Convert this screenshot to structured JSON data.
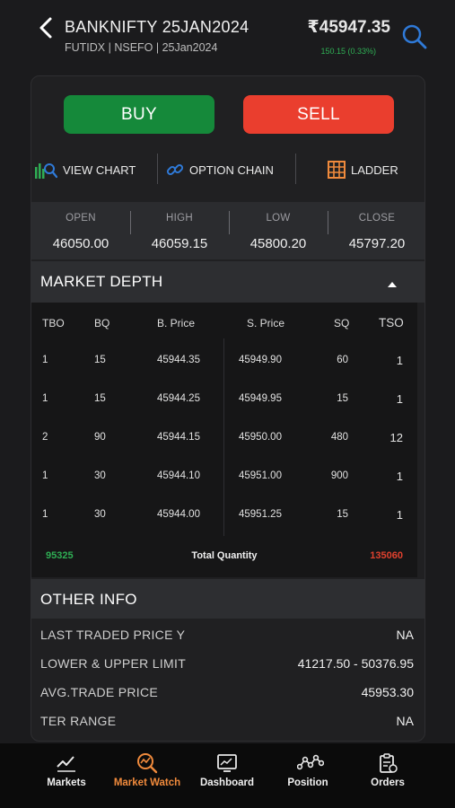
{
  "header": {
    "symbol": "BANKNIFTY 25JAN2024",
    "subtitle": "FUTIDX | NSEFO | 25Jan2024",
    "ltp": "₹45947.35",
    "change": "150.15 (0.33%)"
  },
  "colors": {
    "buy": "#15893a",
    "sell": "#ea3e2e",
    "positive": "#2fae54",
    "negative": "#e0412e",
    "accent": "#f08a3c",
    "search": "#2f7ad8"
  },
  "buttons": {
    "buy": "BUY",
    "sell": "SELL"
  },
  "actions": {
    "view_chart": "VIEW CHART",
    "option_chain": "OPTION CHAIN",
    "ladder": "LADDER"
  },
  "ohlc": [
    {
      "label": "OPEN",
      "value": "46050.00"
    },
    {
      "label": "HIGH",
      "value": "46059.15"
    },
    {
      "label": "LOW",
      "value": "45800.20"
    },
    {
      "label": "CLOSE",
      "value": "45797.20"
    }
  ],
  "market_depth": {
    "title": "MARKET DEPTH",
    "columns": {
      "tbo": "TBO",
      "bq": "BQ",
      "bprice": "B. Price",
      "sprice": "S. Price",
      "sq": "SQ",
      "tso": "TSO"
    },
    "rows": [
      {
        "tbo": "1",
        "bq": "15",
        "bprice": "45944.35",
        "sprice": "45949.90",
        "sq": "60",
        "tso": "1"
      },
      {
        "tbo": "1",
        "bq": "15",
        "bprice": "45944.25",
        "sprice": "45949.95",
        "sq": "15",
        "tso": "1"
      },
      {
        "tbo": "2",
        "bq": "90",
        "bprice": "45944.15",
        "sprice": "45950.00",
        "sq": "480",
        "tso": "12"
      },
      {
        "tbo": "1",
        "bq": "30",
        "bprice": "45944.10",
        "sprice": "45951.00",
        "sq": "900",
        "tso": "1"
      },
      {
        "tbo": "1",
        "bq": "30",
        "bprice": "45944.00",
        "sprice": "45951.25",
        "sq": "15",
        "tso": "1"
      }
    ],
    "total_buy": "95325",
    "total_label": "Total Quantity",
    "total_sell": "135060"
  },
  "other_info": {
    "title": "OTHER INFO",
    "rows": [
      {
        "label": "LAST TRADED PRICE Y",
        "value": "NA"
      },
      {
        "label": "LOWER & UPPER LIMIT",
        "value": "41217.50 - 50376.95"
      },
      {
        "label": "AVG.TRADE PRICE",
        "value": "45953.30"
      },
      {
        "label": "TER RANGE",
        "value": "NA"
      }
    ]
  },
  "nav": [
    {
      "label": "Markets",
      "icon": "markets-icon"
    },
    {
      "label": "Market Watch",
      "icon": "market-watch-icon",
      "active": true
    },
    {
      "label": "Dashboard",
      "icon": "dashboard-icon"
    },
    {
      "label": "Position",
      "icon": "position-icon"
    },
    {
      "label": "Orders",
      "icon": "orders-icon"
    }
  ]
}
